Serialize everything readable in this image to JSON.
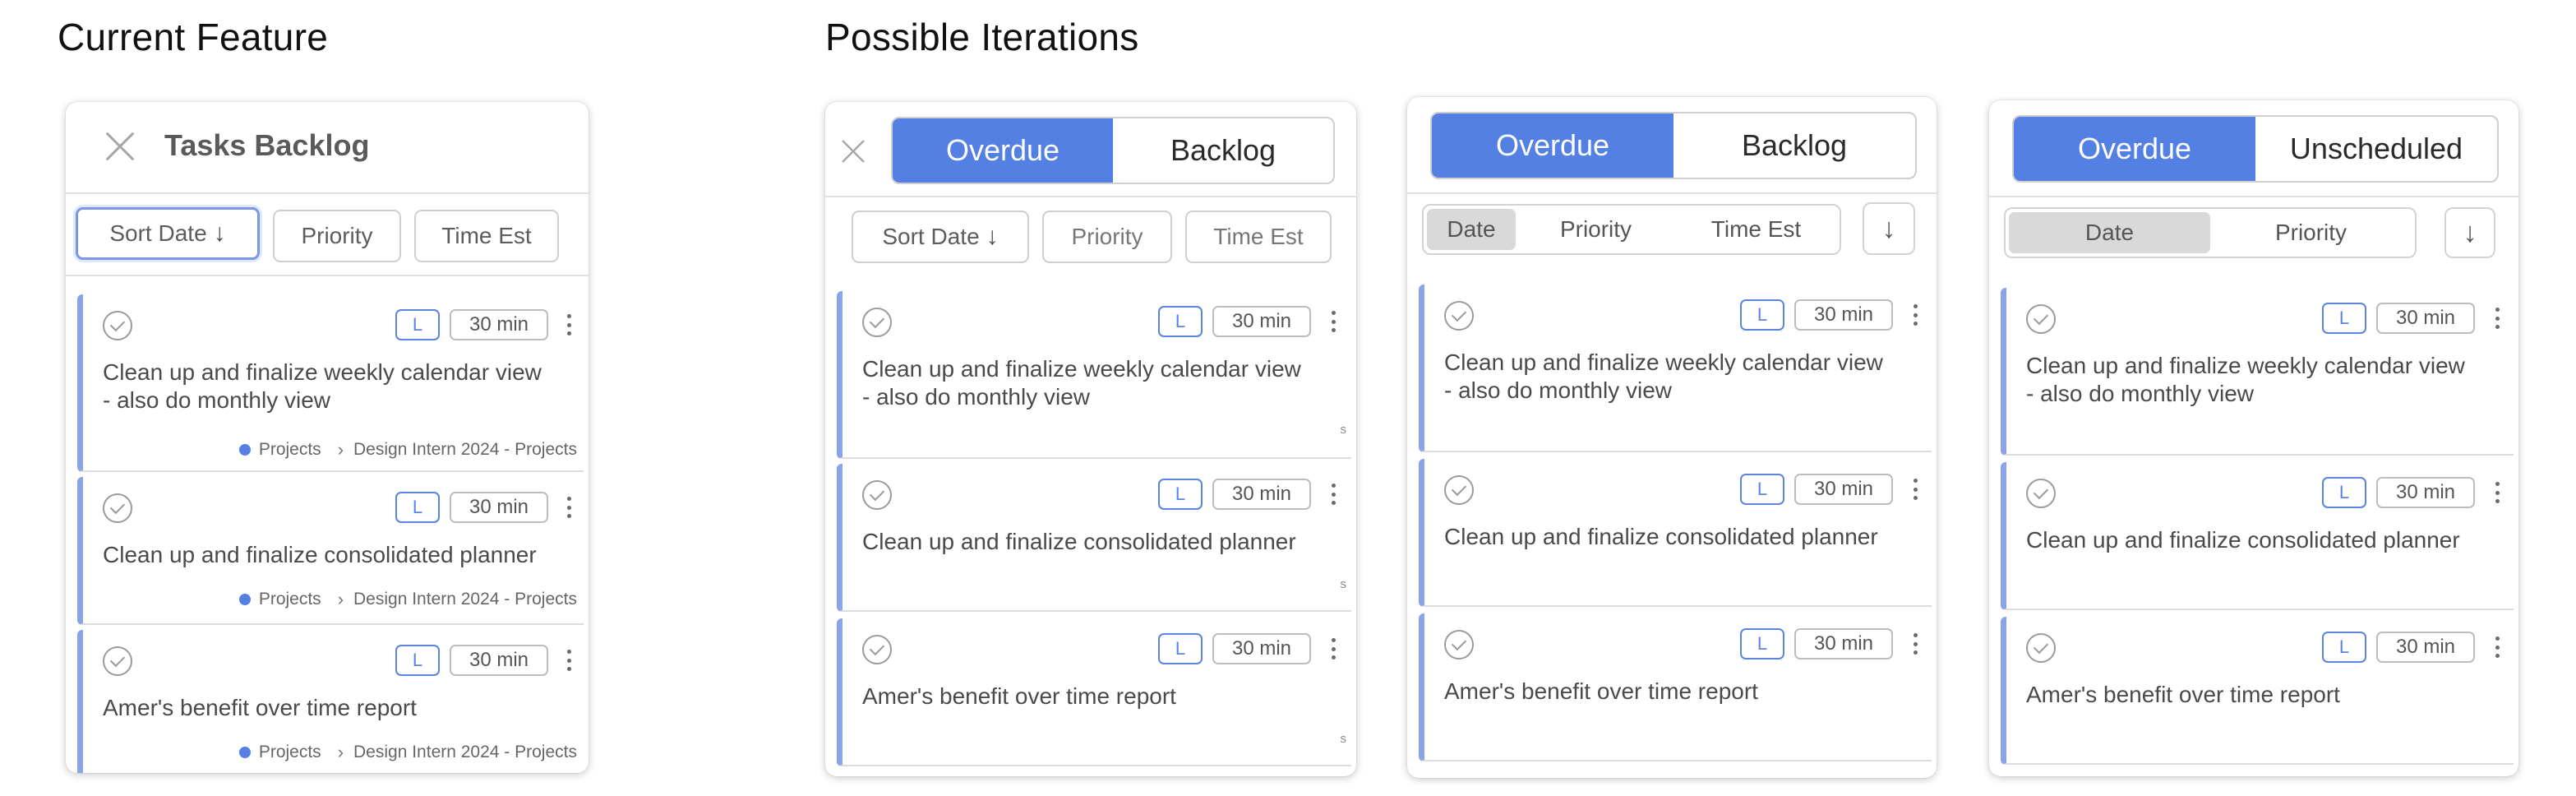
{
  "headings": {
    "current": "Current Feature",
    "iterations": "Possible Iterations"
  },
  "panel1": {
    "title": "Tasks Backlog",
    "sort_date": "Sort Date",
    "priority": "Priority",
    "time_est": "Time Est"
  },
  "panel2": {
    "tab_overdue": "Overdue",
    "tab_backlog": "Backlog",
    "sort_date": "Sort Date",
    "priority": "Priority",
    "time_est": "Time Est"
  },
  "panel3": {
    "tab_overdue": "Overdue",
    "tab_backlog": "Backlog",
    "seg_date": "Date",
    "seg_priority": "Priority",
    "seg_time_est": "Time Est"
  },
  "panel4": {
    "tab_overdue": "Overdue",
    "tab_unscheduled": "Unscheduled",
    "seg_date": "Date",
    "seg_priority": "Priority"
  },
  "tasks": [
    {
      "title_line1": "Clean up and finalize weekly calendar view",
      "title_line2": "- also do monthly view",
      "size": "L",
      "time": "30 min"
    },
    {
      "title_line1": "Clean up and finalize consolidated planner",
      "size": "L",
      "time": "30 min"
    },
    {
      "title_line1": "Amer's benefit over time report",
      "size": "L",
      "time": "30 min"
    }
  ],
  "meta": {
    "project": "Projects",
    "path": "Design Intern 2024 - Projects"
  },
  "truncated_glyph": "s",
  "colors": {
    "accent": "#5580e3",
    "card_bar": "#8aa4ea",
    "badge_l": "#5b84e4",
    "focus_ring": "#7b97e6"
  },
  "icons": [
    "close-icon",
    "arrow-down-icon",
    "check-circle-icon",
    "kebab-icon",
    "chevron-right-icon"
  ]
}
